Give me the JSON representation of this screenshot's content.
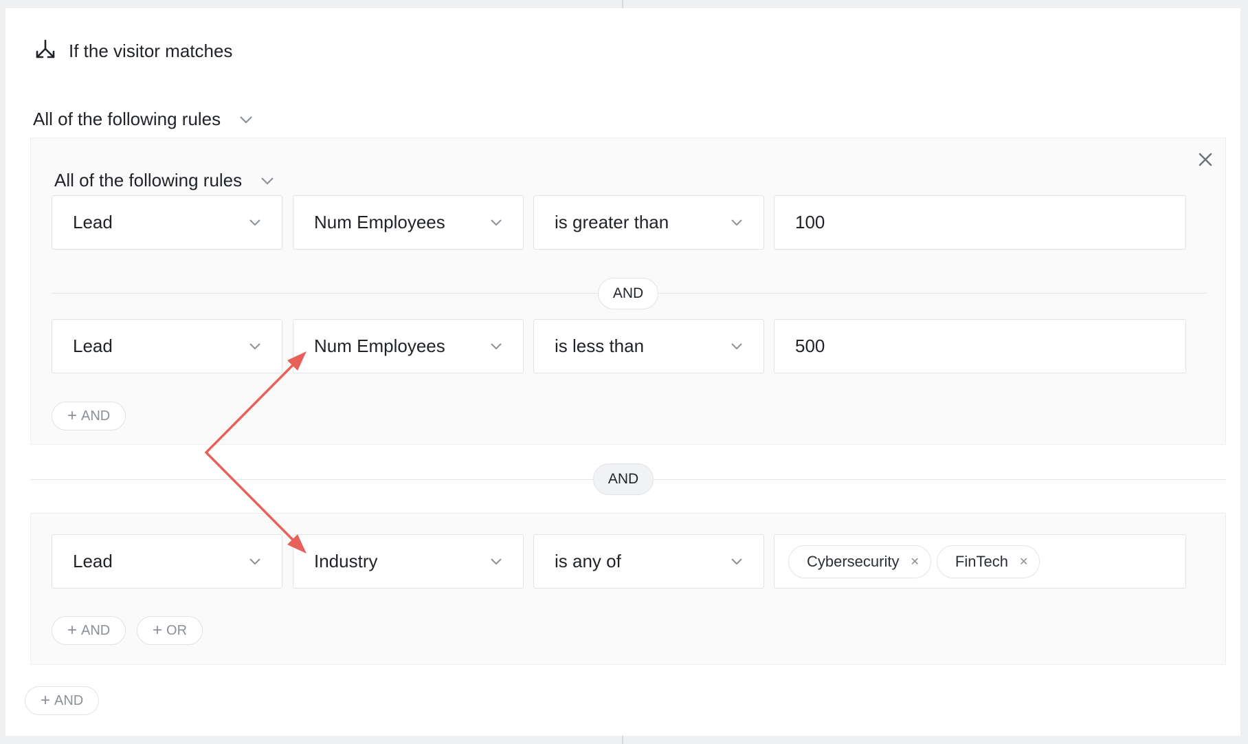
{
  "header": {
    "title": "If the visitor matches",
    "icon": "split-arrows-icon"
  },
  "top_match": {
    "label": "All of the following rules"
  },
  "group1": {
    "match_label": "All of the following rules",
    "rules": [
      {
        "entity": "Lead",
        "attribute": "Num Employees",
        "operator": "is greater than",
        "value": "100"
      },
      {
        "entity": "Lead",
        "attribute": "Num Employees",
        "operator": "is less than",
        "value": "500"
      }
    ],
    "connector": "AND",
    "add_and": "AND"
  },
  "between_groups": "AND",
  "group2": {
    "rule": {
      "entity": "Lead",
      "attribute": "Industry",
      "operator": "is any of",
      "tags": [
        "Cybersecurity",
        "FinTech"
      ]
    },
    "add_and": "AND",
    "add_or": "OR"
  },
  "bottom_add_and": "AND",
  "colors": {
    "annotation_arrow": "#e8605a",
    "muted": "#8a9097"
  }
}
